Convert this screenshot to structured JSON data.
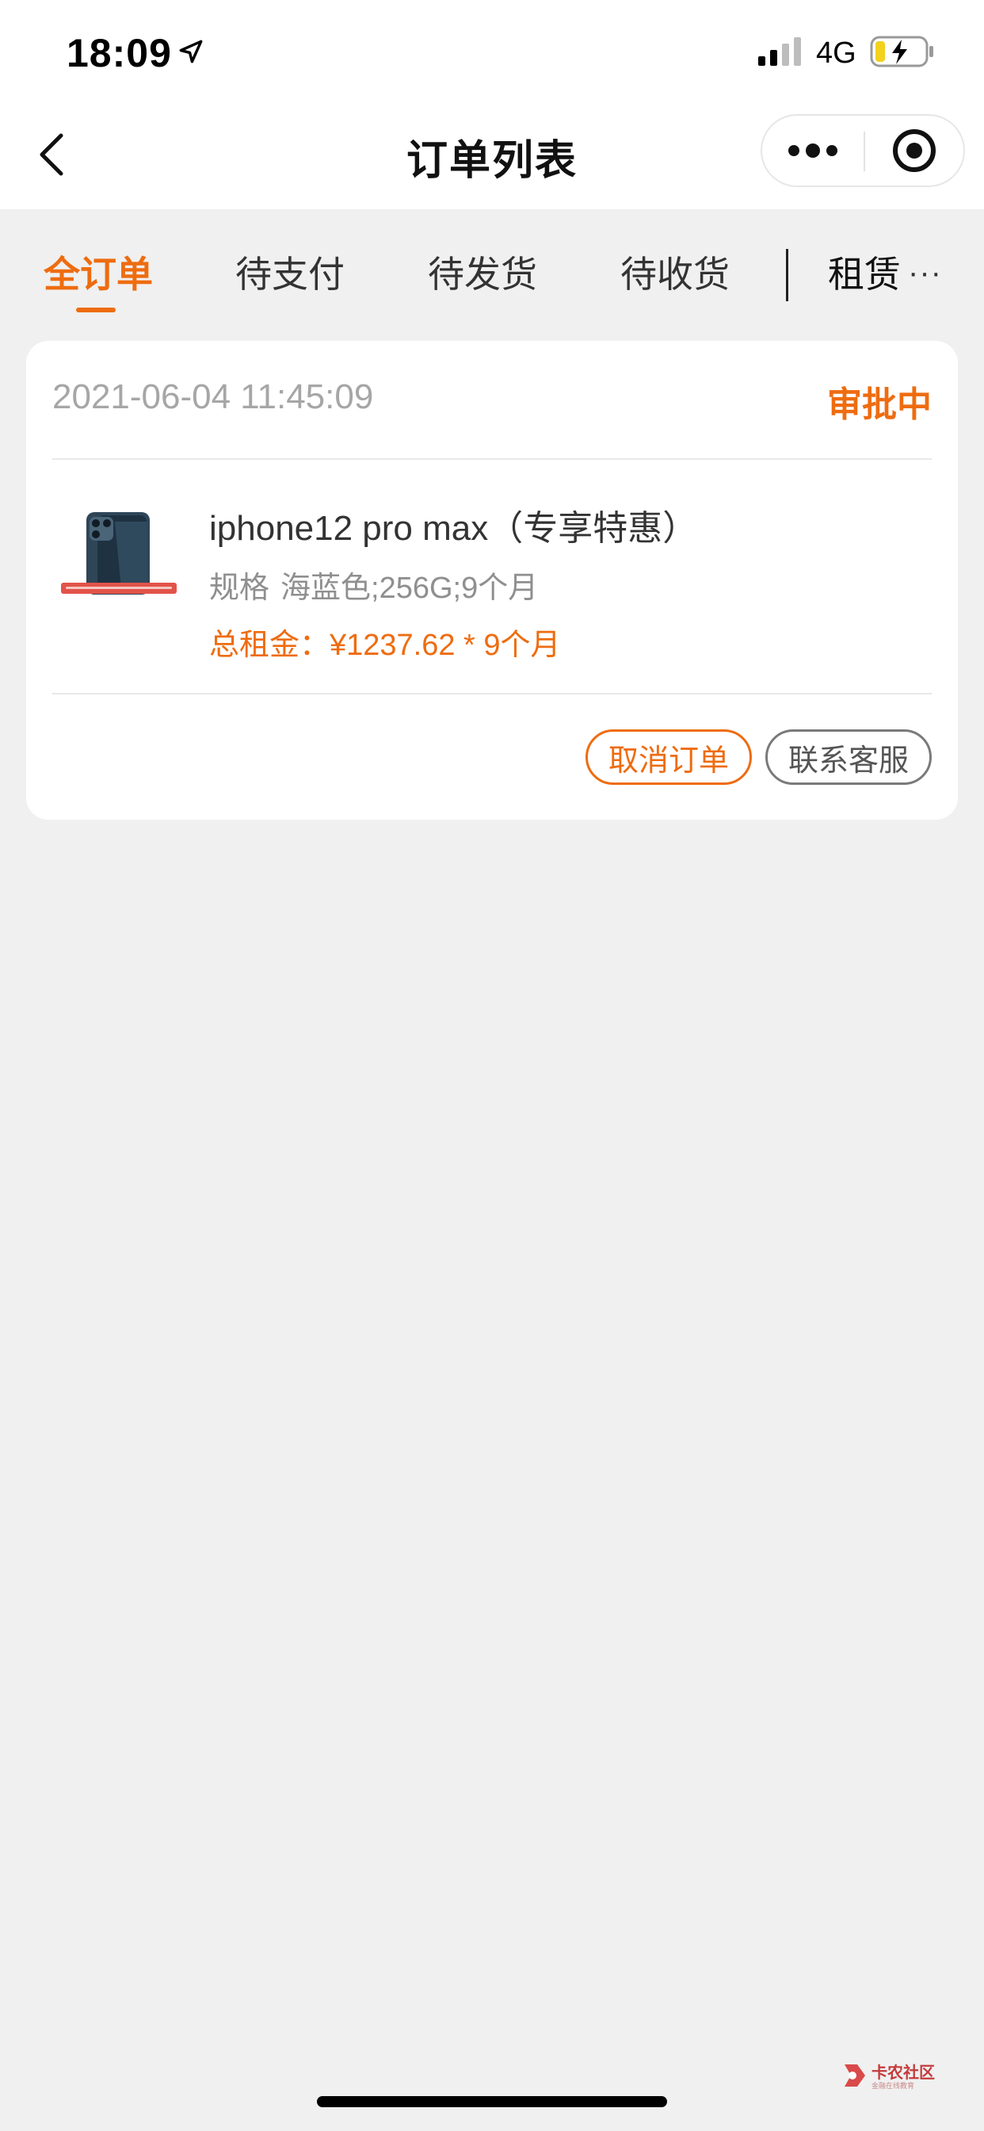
{
  "status_bar": {
    "time": "18:09",
    "network": "4G",
    "icons": [
      "location-arrow-icon",
      "signal-icon",
      "battery-charging-icon"
    ]
  },
  "nav": {
    "title": "订单列表",
    "back_icon": "chevron-left-icon",
    "more_icon": "more-dots-icon",
    "close_icon": "target-close-icon"
  },
  "tabs": [
    {
      "label": "全订单",
      "active": true
    },
    {
      "label": "待支付",
      "active": false
    },
    {
      "label": "待发货",
      "active": false
    },
    {
      "label": "待收货",
      "active": false
    },
    {
      "label": "租赁",
      "active": false
    }
  ],
  "tab_more": "···",
  "order": {
    "time": "2021-06-04 11:45:09",
    "status": "审批中",
    "product": {
      "name": "iphone12 pro max（专享特惠）",
      "spec_label": "规格",
      "spec_value": "海蓝色;256G;9个月",
      "total": "总租金：¥1237.62 * 9个月"
    },
    "actions": {
      "cancel": "取消订单",
      "service": "联系客服"
    }
  },
  "watermark": {
    "text": "卡农社区",
    "sub": "金融在线教育"
  },
  "colors": {
    "accent": "#ee6c10",
    "background": "#f0f0f0",
    "card": "#ffffff",
    "muted_text": "#a6a6a6"
  }
}
